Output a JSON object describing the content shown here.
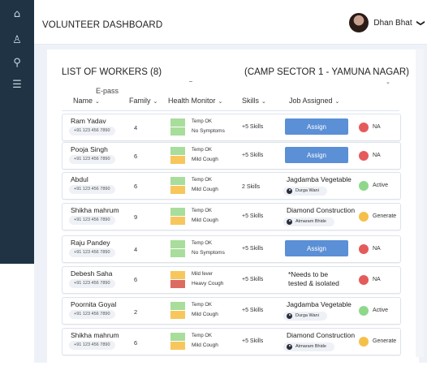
{
  "sidebar": {
    "icons": [
      {
        "name": "home-icon",
        "glyph": "⌂"
      },
      {
        "name": "users-icon",
        "glyph": "♙"
      },
      {
        "name": "search-icon",
        "glyph": "⚲"
      },
      {
        "name": "list-icon",
        "glyph": "☰"
      }
    ]
  },
  "header": {
    "title": "VOLUNTEER DASHBOARD",
    "user_name": "Dhan Bhat",
    "chevron": "❯"
  },
  "list": {
    "title": "LIST OF WORKERS (8)",
    "camp": "(CAMP SECTOR 1 - YAMUNA NAGAR)",
    "epass_label": "E-pass",
    "camp_caret": "⌄"
  },
  "columns": {
    "name": "Name",
    "family": "Family",
    "health": "Health Monitor",
    "skills": "Skills",
    "job": "Job Assigned",
    "caret": "⌄"
  },
  "colors": {
    "sidebar": "#1f3345",
    "assign_button": "#5b8fd6",
    "green": "#a8dd9c",
    "orange": "#f7c75d",
    "red": "#dd6b62",
    "status_red": "#e55b5b",
    "status_green": "#8fd88a",
    "status_orange": "#f5c04a"
  },
  "assign_label": "Assign",
  "workers": [
    {
      "name": "Ram Yadav",
      "phone": "+91 123 456 7890",
      "family": "4",
      "temp": "Temp OK",
      "symptom": "No Symptoms",
      "health_colors": [
        "#a8dd9c",
        "#a8dd9c"
      ],
      "skills": "+5 Skills",
      "job_type": "button",
      "status": "NA",
      "status_color": "#e55b5b"
    },
    {
      "name": "Pooja Singh",
      "phone": "+91 123 456 7890",
      "family": "6",
      "temp": "Temp OK",
      "symptom": "Mild Cough",
      "health_colors": [
        "#a8dd9c",
        "#f7c75d"
      ],
      "skills": "+5 Skills",
      "job_type": "button",
      "status": "NA",
      "status_color": "#e55b5b"
    },
    {
      "name": "Abdul",
      "phone": "+91 123 456 7890",
      "family": "6",
      "temp": "Temp OK",
      "symptom": "Mild Cough",
      "health_colors": [
        "#a8dd9c",
        "#f7c75d"
      ],
      "skills": "2 Skills",
      "job_type": "assigned",
      "job": "Jagdamba  Vegetable",
      "assignee": "Durga Wani",
      "status": "Active",
      "status_color": "#8fd88a"
    },
    {
      "name": "Shikha mahrum",
      "phone": "+91 123 456 7890",
      "family": "9",
      "temp": "Temp OK",
      "symptom": "Mild Cough",
      "health_colors": [
        "#a8dd9c",
        "#f7c75d"
      ],
      "skills": "+5 Skills",
      "job_type": "assigned",
      "job": "Diamond Construction",
      "assignee": "Atmaram Bhide",
      "status": "Generate",
      "status_color": "#f5c04a"
    },
    {
      "name": "Raju Pandey",
      "phone": "+91 123 456 7890",
      "family": "4",
      "temp": "Temp OK",
      "symptom": "No Symptoms",
      "health_colors": [
        "#a8dd9c",
        "#a8dd9c"
      ],
      "skills": "+5 Skills",
      "job_type": "button",
      "status": "NA",
      "status_color": "#e55b5b"
    },
    {
      "name": "Debesh Saha",
      "phone": "+91 123 456 7890",
      "family": "6",
      "temp": "Mild fever",
      "symptom": "Heavy Cough",
      "health_colors": [
        "#f7c75d",
        "#dd6b62"
      ],
      "skills": "+5 Skills",
      "job_type": "note",
      "job_line1": "*Needs to be",
      "job_line2": "tested & isolated",
      "status": "NA",
      "status_color": "#e55b5b"
    },
    {
      "name": "Poornita Goyal",
      "phone": "+91 123 456 7890",
      "family": "2",
      "temp": "Temp OK",
      "symptom": "Mild Cough",
      "health_colors": [
        "#a8dd9c",
        "#f7c75d"
      ],
      "skills": "+5 Skills",
      "job_type": "assigned",
      "job": "Jagdamba  Vegetable",
      "assignee": "Durga Wani",
      "status": "Active",
      "status_color": "#8fd88a"
    },
    {
      "name": "Shikha mahrum",
      "phone": "+91 123 456 7890",
      "family": "6",
      "temp": "Temp OK",
      "symptom": "Mild Cough",
      "health_colors": [
        "#a8dd9c",
        "#f7c75d"
      ],
      "skills": "+5 Skills",
      "job_type": "assigned",
      "job": "Diamond Construction",
      "assignee": "Atmaram Bhide",
      "status": "Generate",
      "status_color": "#f5c04a"
    }
  ]
}
